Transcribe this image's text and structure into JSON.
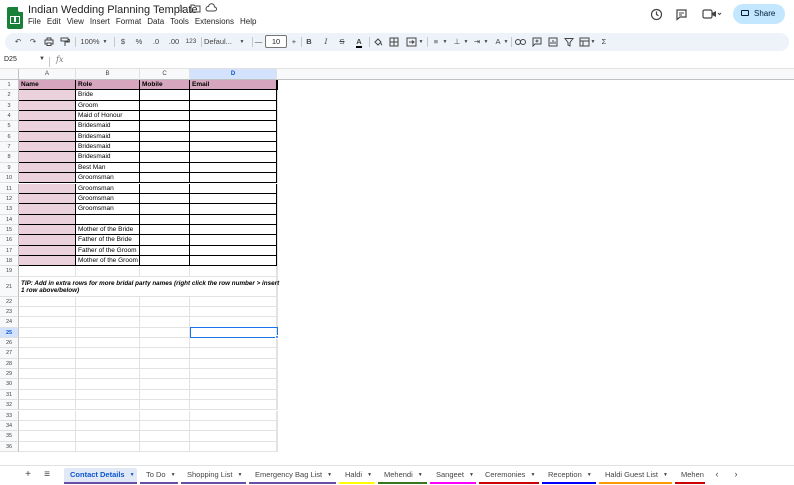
{
  "doc": {
    "title": "Indian Wedding Planning Template"
  },
  "menu": [
    "File",
    "Edit",
    "View",
    "Insert",
    "Format",
    "Data",
    "Tools",
    "Extensions",
    "Help"
  ],
  "share_label": "Share",
  "toolbar": {
    "zoom": "100%",
    "currency": "$",
    "percent": "%",
    "dec_less": ".0",
    "dec_more": ".00",
    "fmt123": "123",
    "font": "Defaul...",
    "minus": "—",
    "font_size": "10",
    "plus": "+",
    "bold": "B",
    "italic": "I",
    "sigma": "Σ"
  },
  "formula_bar": {
    "cell_ref": "D25",
    "fx": "fx"
  },
  "columns": [
    "A",
    "B",
    "C",
    "D"
  ],
  "header_row": [
    "Name",
    "Role",
    "Mobile",
    "Email"
  ],
  "roles": [
    "Bride",
    "Groom",
    "Maid of Honour",
    "Bridesmaid",
    "Bridesmaid",
    "Bridesmaid",
    "Bridesmaid",
    "Best Man",
    "Groomsman",
    "Groomsman",
    "Groomsman",
    "Groomsman",
    "",
    "Mother of the Bride",
    "Father of the Bride",
    "Father of the Groom",
    "Mother of the Groom"
  ],
  "row_numbers": [
    "1",
    "2",
    "3",
    "4",
    "5",
    "6",
    "7",
    "8",
    "9",
    "10",
    "11",
    "12",
    "13",
    "14",
    "15",
    "16",
    "17",
    "18",
    "19",
    "21",
    "22",
    "23",
    "24",
    "25",
    "26",
    "27",
    "28",
    "29",
    "30",
    "31",
    "32",
    "33",
    "34",
    "35",
    "36"
  ],
  "tip": "TIP: Add in extra rows for more bridal party names (right click the row number > insert 1 row above/below)",
  "sheet_tabs": [
    {
      "label": "Contact Details",
      "color": "#674ea7"
    },
    {
      "label": "To Do",
      "color": "#674ea7"
    },
    {
      "label": "Shopping List",
      "color": "#674ea7"
    },
    {
      "label": "Emergency Bag List",
      "color": "#674ea7"
    },
    {
      "label": "Haldi",
      "color": "#ffff00"
    },
    {
      "label": "Mehendi",
      "color": "#38761d"
    },
    {
      "label": "Sangeet",
      "color": "#ff00ff"
    },
    {
      "label": "Ceremonies",
      "color": "#cc0000"
    },
    {
      "label": "Reception",
      "color": "#0000ff"
    },
    {
      "label": "Haldi Guest List",
      "color": "#ff9900"
    },
    {
      "label": "Mehen",
      "color": "#cc0000"
    }
  ],
  "colors": {
    "header_pink": "#d5a6bd",
    "name_pink": "#ead1dc",
    "accent": "#1a73e8"
  }
}
